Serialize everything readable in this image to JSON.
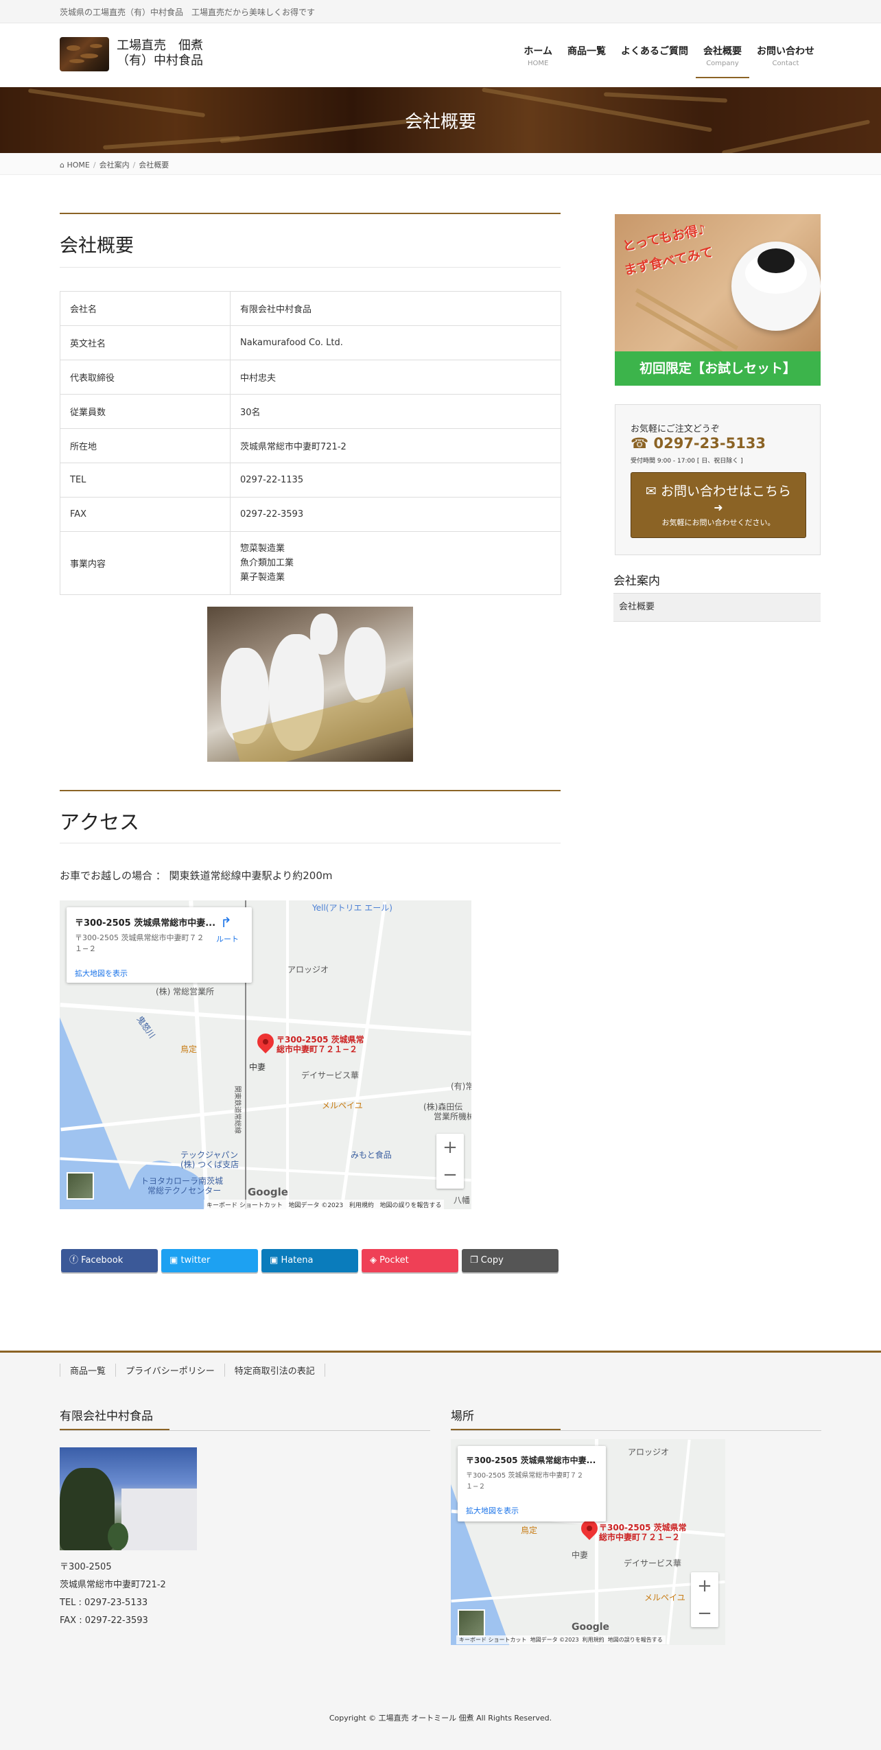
{
  "topbar": {
    "text": "茨城県の工場直売（有）中村食品　工場直売だから美味しくお得です"
  },
  "header": {
    "logo_line1": "工場直売　佃煮",
    "logo_line2": "（有）中村食品",
    "nav": [
      {
        "jp": "ホーム",
        "en": "HOME"
      },
      {
        "jp": "商品一覧",
        "en": ""
      },
      {
        "jp": "よくあるご質問",
        "en": ""
      },
      {
        "jp": "会社概要",
        "en": "Company"
      },
      {
        "jp": "お問い合わせ",
        "en": "Contact"
      }
    ]
  },
  "hero": {
    "title": "会社概要"
  },
  "breadcrumb": {
    "home": "HOME",
    "parent": "会社案内",
    "current": "会社概要"
  },
  "company": {
    "title": "会社概要",
    "rows": [
      {
        "key": "会社名",
        "value": "有限会社中村食品"
      },
      {
        "key": "英文社名",
        "value": "Nakamurafood Co. Ltd."
      },
      {
        "key": "代表取締役",
        "value": "中村忠夫"
      },
      {
        "key": "従業員数",
        "value": "30名"
      },
      {
        "key": "所在地",
        "value": "茨城県常総市中妻町721-2"
      },
      {
        "key": "TEL",
        "value": "0297-22-1135"
      },
      {
        "key": "FAX",
        "value": "0297-22-3593"
      }
    ],
    "business_key": "事業内容",
    "business_values": [
      "惣菜製造業",
      "魚介類加工業",
      "菓子製造業"
    ]
  },
  "access": {
    "title": "アクセス",
    "text": "お車でお越しの場合 ： 関東鉄道常総線中妻駅より約200m"
  },
  "map": {
    "card_title": "〒300-2505 茨城県常総市中妻...",
    "card_addr1": "〒300-2505 茨城県常総市中妻町７２",
    "card_addr2": "１−２",
    "card_link": "拡大地図を表示",
    "route": "ルート",
    "marker1": "〒300-2505 茨城県常",
    "marker2": "総市中妻町７２１−２",
    "labels": {
      "yell": "Yell(アトリエ エール)",
      "arojji": "アロッジオ",
      "joso": "(株) 常総営業所",
      "kinugawa": "鬼怒川",
      "torisada": "鳥定",
      "nakatsuma": "中妻",
      "daisabisu": "デイサービス華",
      "merupeiyu": "メルペイユ",
      "morita1": "(株)森田伝",
      "morita2": "営業所機械",
      "yu": "(有)常",
      "tekku1": "テックジャパン",
      "tekku2": "(株) つくば支店",
      "mitomo": "みもと食品",
      "toyota1": "トヨタカローラ南茨城",
      "toyota2": "常総テクノセンター",
      "line": "関東鉄道常総線",
      "hachi": "八幡"
    },
    "footer_items": [
      "キーボード ショートカット",
      "地図データ ©2023",
      "利用規約",
      "地図の誤りを報告する"
    ],
    "google": "Google"
  },
  "share": [
    {
      "label": "Facebook",
      "color": "#3b5998",
      "icon": "facebook-icon"
    },
    {
      "label": "twitter",
      "color": "#1da1f2",
      "icon": "twitter-icon"
    },
    {
      "label": "Hatena",
      "color": "#008fde",
      "icon": "hatena-icon"
    },
    {
      "label": "Pocket",
      "color": "#ef4056",
      "icon": "pocket-icon"
    },
    {
      "label": "Copy",
      "color": "#555555",
      "icon": "copy-icon"
    }
  ],
  "sidebar": {
    "banner_line1": "とってもお得♪",
    "banner_line2": "まず食べてみて",
    "banner_caption": "初回限定【お試しセット】",
    "contact_intro": "お気軽にご注文どうぞ",
    "phone": "0297-23-5133",
    "hours": "受付時間 9:00 - 17:00 [ 日、祝日除く ]",
    "button_label": "お問い合わせはこちら",
    "button_sub": "お気軽にお問い合わせください。",
    "section_title": "会社案内",
    "section_item": "会社概要"
  },
  "footer": {
    "nav": [
      "商品一覧",
      "プライバシーポリシー",
      "特定商取引法の表記"
    ],
    "company_title": "有限会社中村食品",
    "location_title": "場所",
    "address": [
      "〒300-2505",
      "茨城県常総市中妻町721-2",
      "TEL : 0297-23-5133",
      "FAX : 0297-22-3593"
    ],
    "copyright": "Copyright © 工場直売 オートミール 佃煮 All Rights Reserved."
  },
  "colors": {
    "accent": "#8b6325",
    "green": "#3cb44b"
  }
}
